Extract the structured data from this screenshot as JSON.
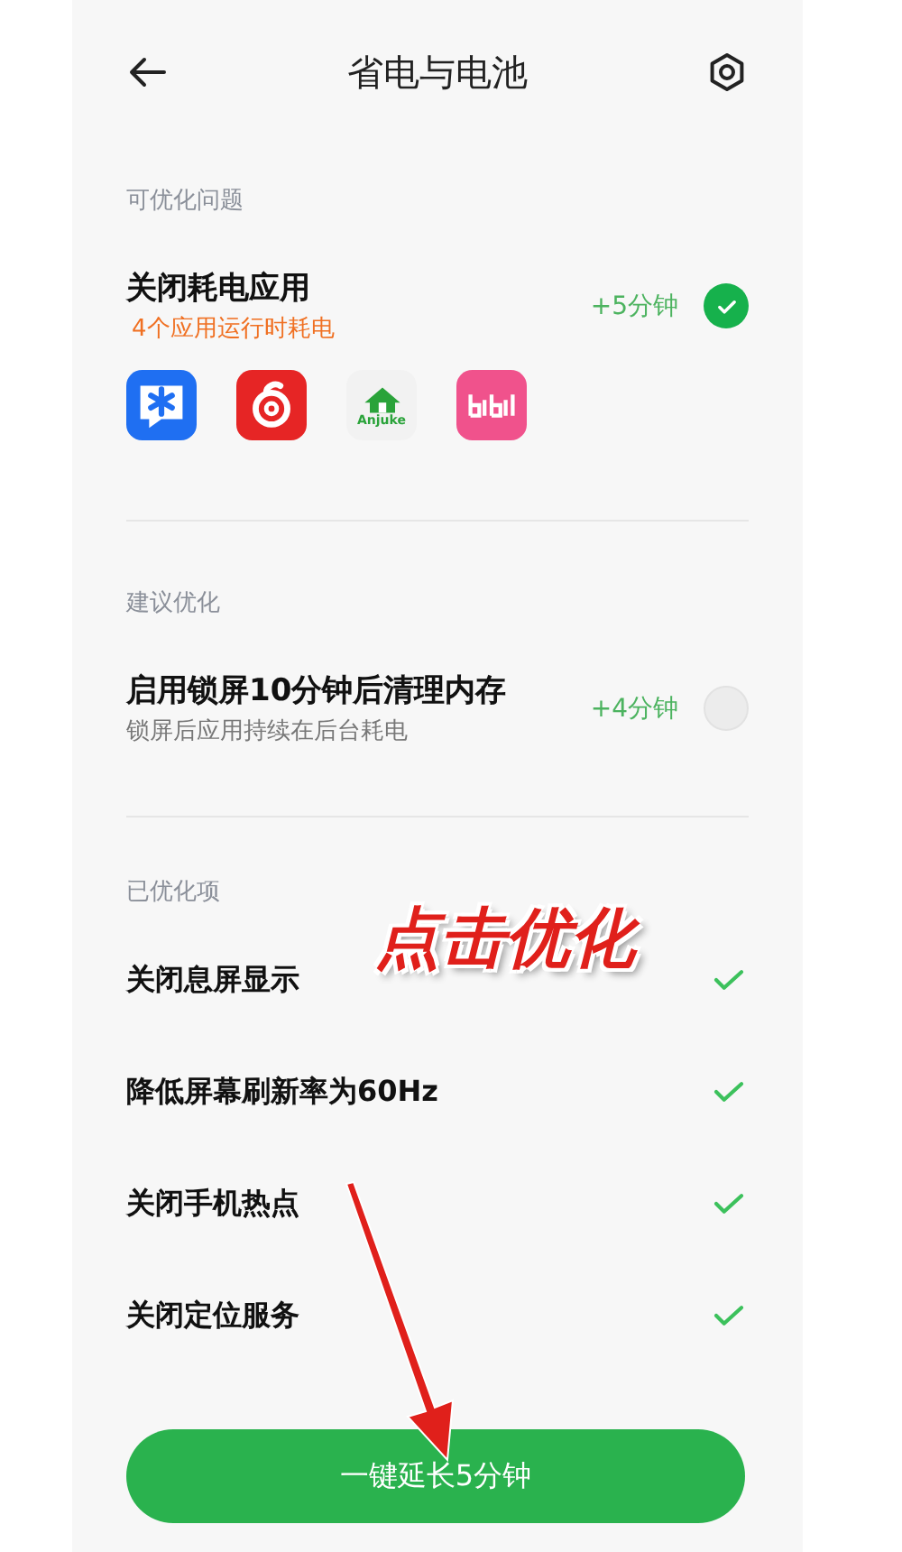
{
  "header": {
    "title": "省电与电池"
  },
  "issues": [
    {
      "section": "可优化问题",
      "title": "关闭耗电应用",
      "subtitle": "4个应用运行时耗电",
      "warning": true,
      "gain": "+5分钟",
      "checked": true,
      "apps": [
        {
          "kind": "chat"
        },
        {
          "kind": "music"
        },
        {
          "kind": "house",
          "label": "Anjuke"
        },
        {
          "kind": "video"
        }
      ]
    },
    {
      "section": "建议优化",
      "title": "启用锁屏10分钟后清理内存",
      "subtitle": "锁屏后应用持续在后台耗电",
      "warning": false,
      "gain": "+4分钟",
      "checked": false
    }
  ],
  "optimized": {
    "section": "已优化项",
    "items": [
      {
        "title": "关闭息屏显示",
        "done": true
      },
      {
        "title": "降低屏幕刷新率为60Hz",
        "done": true
      },
      {
        "title": "关闭手机热点",
        "done": true
      },
      {
        "title": "关闭定位服务",
        "done": true
      }
    ]
  },
  "button": {
    "label": "一键延长5分钟"
  },
  "annotation": {
    "text": "点击优化"
  }
}
